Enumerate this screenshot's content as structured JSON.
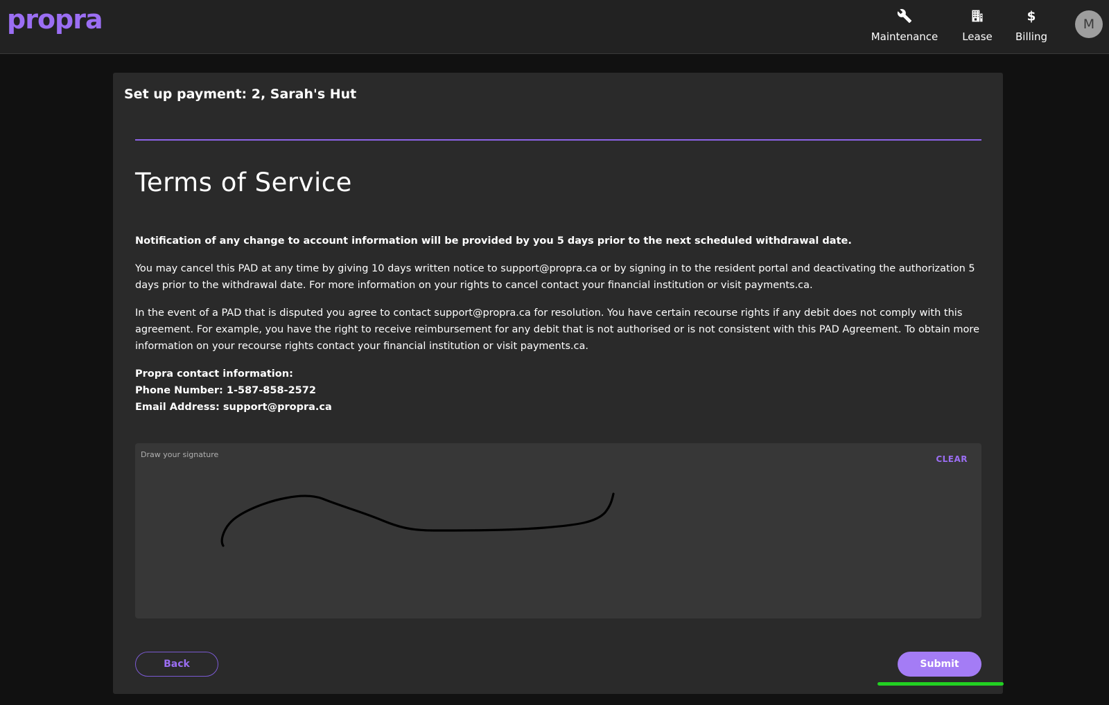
{
  "app": {
    "logo": "propra"
  },
  "nav": {
    "items": [
      {
        "label": "Maintenance",
        "icon": "wrench-icon"
      },
      {
        "label": "Lease",
        "icon": "building-icon"
      },
      {
        "label": "Billing",
        "icon": "dollar-icon"
      }
    ],
    "avatar_initial": "M"
  },
  "page": {
    "title": "Set up payment: 2, Sarah's Hut",
    "heading": "Terms of Service",
    "paragraphs": [
      "Notification of any change to account information will be provided by you 5 days prior to the next scheduled withdrawal date.",
      "You may cancel this PAD at any time by giving 10 days written notice to support@propra.ca or by signing in to the resident portal and deactivating the authorization 5 days prior to the withdrawal date. For more information on your rights to cancel contact your financial institution or visit payments.ca.",
      "In the event of a PAD that is disputed you agree to contact support@propra.ca for resolution. You have certain recourse rights if any debit does not comply with this agreement. For example, you have the right to receive reimbursement for any debit that is not authorised or is not consistent with this PAD Agreement. To obtain more information on your recourse rights contact your financial institution or visit payments.ca."
    ],
    "contact": {
      "heading": "Propra contact information:",
      "phone": "Phone Number: 1-587-858-2572",
      "email": "Email Address: support@propra.ca"
    }
  },
  "signature": {
    "label": "Draw your signature",
    "clear_label": "CLEAR"
  },
  "actions": {
    "back_label": "Back",
    "submit_label": "Submit"
  },
  "colors": {
    "accent": "#9b6ef3",
    "focus": "#22d122"
  }
}
